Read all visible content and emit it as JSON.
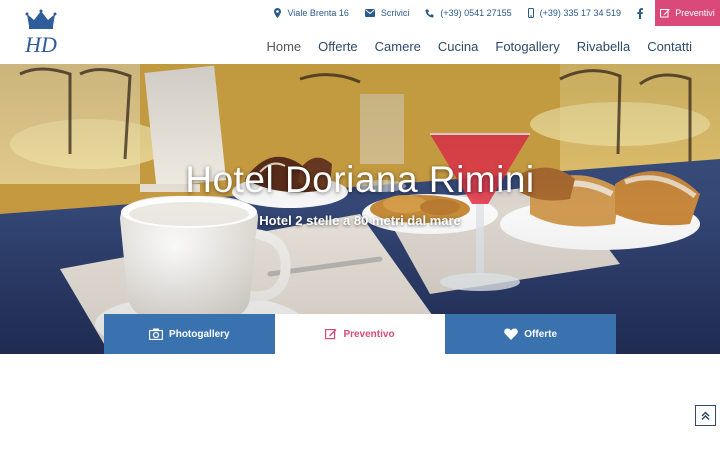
{
  "header": {
    "logo": {
      "letters": "HD",
      "icon": "crown-icon"
    },
    "topbar": {
      "address": "Viale Brenta 16",
      "write": "Scrivici",
      "phone": "(+39) 0541 27155",
      "mobile": "(+39) 335 17 34 519",
      "facebook_icon": "facebook-icon",
      "preventivi": "Preventivi"
    },
    "nav": [
      "Home",
      "Offerte",
      "Camere",
      "Cucina",
      "Fotogallery",
      "Rivabella",
      "Contatti"
    ]
  },
  "hero": {
    "title": "Hotel Doriana Rimini",
    "subtitle": "Hotel 2 stelle a 80 metri dal mare"
  },
  "tabs": [
    {
      "label": "Photogallery",
      "icon": "camera-icon"
    },
    {
      "label": "Preventivo",
      "icon": "edit-icon"
    },
    {
      "label": "Offerte",
      "icon": "heart-icon"
    }
  ],
  "colors": {
    "nav_text": "#2d4a6b",
    "accent_pink": "#d94a7a",
    "tab_blue": "#3a72b0"
  }
}
